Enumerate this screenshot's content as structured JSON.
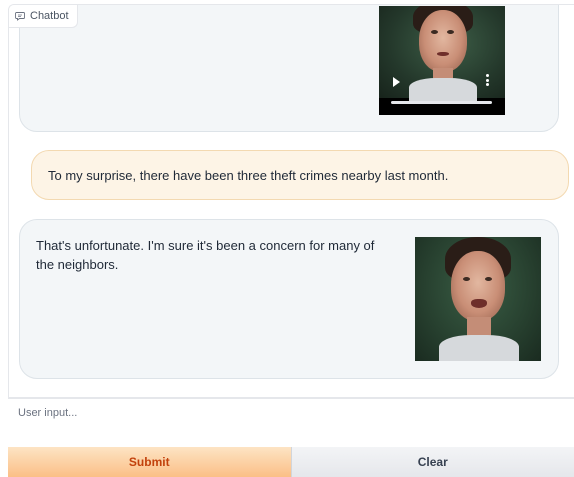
{
  "chatbot": {
    "label": "Chatbot",
    "icon": "chat-bubble-icon"
  },
  "messages": [
    {
      "role": "bot",
      "media": "video",
      "controls": {
        "play_icon": "play-icon",
        "menu_icon": "more-vertical-icon"
      }
    },
    {
      "role": "user",
      "text": "To my surprise, there have been three theft crimes nearby last month."
    },
    {
      "role": "bot",
      "text": "That's unfortunate. I'm sure it's been a concern for many of the neighbors.",
      "media": "image"
    }
  ],
  "input": {
    "placeholder": "User input...",
    "value": ""
  },
  "buttons": {
    "submit": "Submit",
    "clear": "Clear"
  },
  "colors": {
    "user_bubble": "#fdf4e6",
    "bot_bubble": "#f3f6f8",
    "submit_text": "#c2410c",
    "submit_bg": "#fbbf86"
  }
}
